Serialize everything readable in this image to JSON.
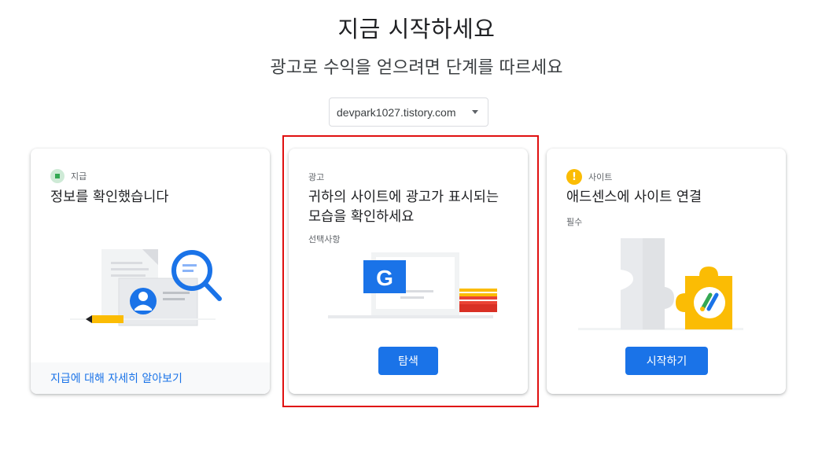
{
  "header": {
    "title": "지금 시작하세요",
    "subtitle": "광고로 수익을 얻으려면 단계를 따르세요"
  },
  "site_selector": {
    "value": "devpark1027.tistory.com"
  },
  "cards": [
    {
      "status_label": "지급",
      "title": "정보를 확인했습니다",
      "footer_link": "지급에 대해 자세히 알아보기"
    },
    {
      "status_label": "광고",
      "title": "귀하의 사이트에 광고가 표시되는 모습을 확인하세요",
      "note": "선택사항",
      "button_label": "탐색",
      "illustration_letter": "G"
    },
    {
      "status_label": "사이트",
      "status_icon": "!",
      "title": "애드센스에 사이트 연결",
      "note": "필수",
      "button_label": "시작하기"
    }
  ],
  "colors": {
    "primary": "#1a73e8",
    "success": "#34a853",
    "warning": "#fbbc04",
    "highlight": "#e01010"
  }
}
